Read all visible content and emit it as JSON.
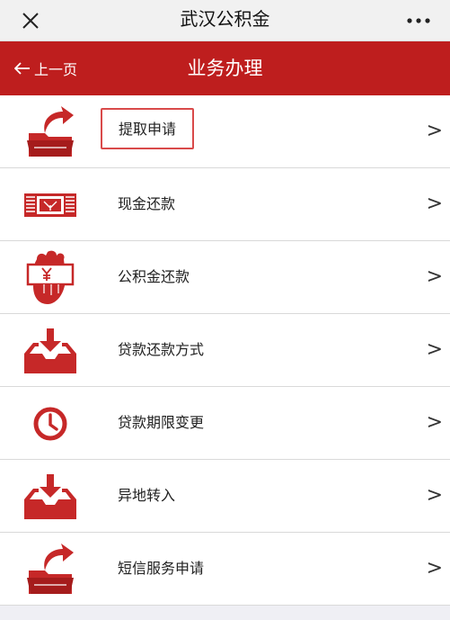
{
  "topbar": {
    "title": "武汉公积金",
    "close_icon": "close-icon",
    "more_icon": "more-icon"
  },
  "header": {
    "back_label": "上一页",
    "title": "业务办理",
    "background": "#be1e1e"
  },
  "menu": {
    "arrow": ">",
    "items": [
      {
        "label": "提取申请",
        "icon": "folder-out-icon",
        "highlighted": true
      },
      {
        "label": "现金还款",
        "icon": "cash-stack-icon"
      },
      {
        "label": "公积金还款",
        "icon": "hand-yuan-icon"
      },
      {
        "label": "贷款还款方式",
        "icon": "inbox-download-icon"
      },
      {
        "label": "贷款期限变更",
        "icon": "clock-icon"
      },
      {
        "label": "异地转入",
        "icon": "inbox-download-icon"
      },
      {
        "label": "短信服务申请",
        "icon": "folder-out-icon"
      }
    ]
  }
}
